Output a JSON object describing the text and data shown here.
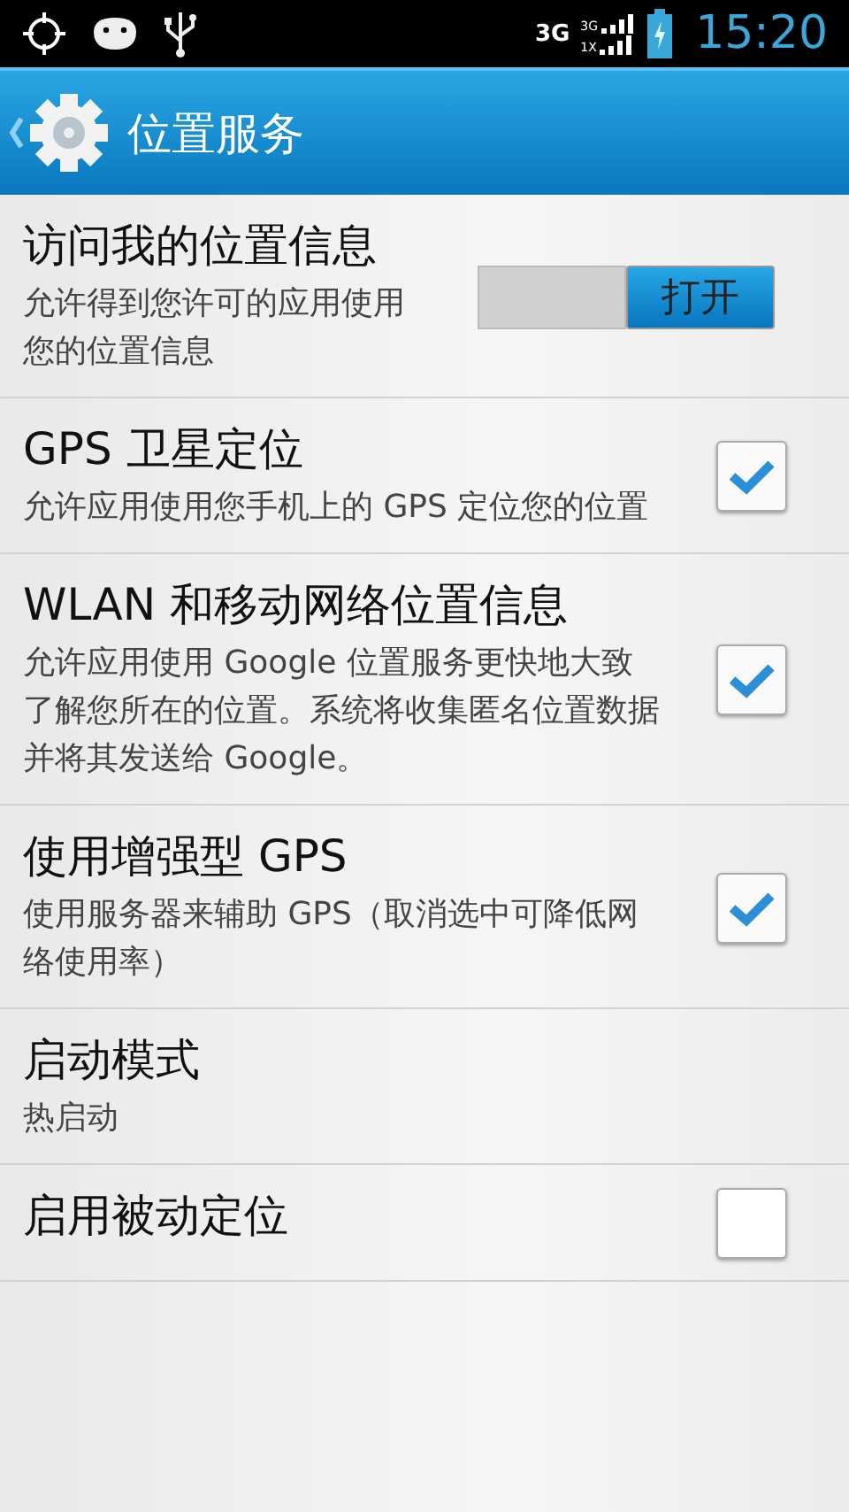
{
  "status_bar": {
    "network": "3G",
    "signal_labels": [
      "3G",
      "1X"
    ],
    "time": "15:20"
  },
  "action_bar": {
    "title": "位置服务"
  },
  "settings": [
    {
      "kind": "switch",
      "title": "访问我的位置信息",
      "summary": "允许得到您许可的应用使用您的位置信息",
      "on": true,
      "switch_label": "打开"
    },
    {
      "kind": "checkbox",
      "title": "GPS 卫星定位",
      "summary": "允许应用使用您手机上的 GPS 定位您的位置",
      "checked": true
    },
    {
      "kind": "checkbox",
      "title": "WLAN 和移动网络位置信息",
      "summary": "允许应用使用 Google 位置服务更快地大致了解您所在的位置。系统将收集匿名位置数据并将其发送给 Google。",
      "checked": true
    },
    {
      "kind": "checkbox",
      "title": "使用增强型 GPS",
      "summary": "使用服务器来辅助 GPS（取消选中可降低网络使用率）",
      "checked": true
    },
    {
      "kind": "plain",
      "title": "启动模式",
      "summary": "热启动"
    },
    {
      "kind": "checkbox",
      "title": "启用被动定位",
      "checked": false
    }
  ]
}
